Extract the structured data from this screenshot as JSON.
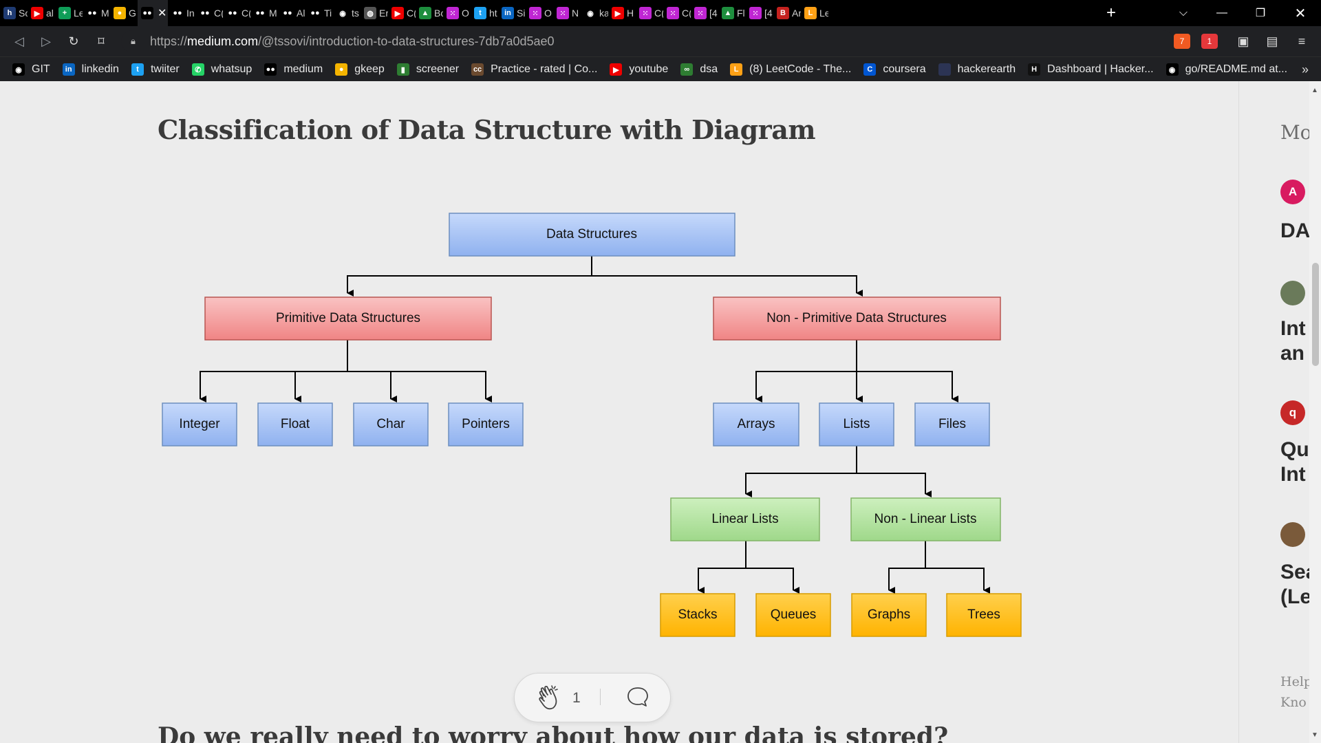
{
  "browser": {
    "tabs": [
      {
        "label": "Sc",
        "icon": "hackerrank-icon",
        "color": "#1f3b73",
        "glyph": "h"
      },
      {
        "label": "al",
        "icon": "youtube-icon",
        "color": "#e00",
        "glyph": "▶"
      },
      {
        "label": "Le",
        "icon": "sheets-icon",
        "color": "#0f9d58",
        "glyph": "+"
      },
      {
        "label": "M",
        "icon": "medium-icon",
        "color": "#000",
        "glyph": "●●"
      },
      {
        "label": "G",
        "icon": "keep-icon",
        "color": "#f4b400",
        "glyph": "●"
      },
      {
        "label": "",
        "icon": "medium-icon",
        "color": "#000",
        "glyph": "●●",
        "active": true
      },
      {
        "label": "In",
        "icon": "medium-icon",
        "color": "#000",
        "glyph": "●●"
      },
      {
        "label": "C(",
        "icon": "medium-icon",
        "color": "#000",
        "glyph": "●●"
      },
      {
        "label": "C(",
        "icon": "medium-icon",
        "color": "#000",
        "glyph": "●●"
      },
      {
        "label": "M",
        "icon": "medium-icon",
        "color": "#000",
        "glyph": "●●"
      },
      {
        "label": "Al",
        "icon": "medium-icon",
        "color": "#000",
        "glyph": "●●"
      },
      {
        "label": "Ti",
        "icon": "medium-icon",
        "color": "#000",
        "glyph": "●●"
      },
      {
        "label": "ts",
        "icon": "github-icon",
        "color": "#000",
        "glyph": "◉"
      },
      {
        "label": "Er",
        "icon": "globe-icon",
        "color": "#555",
        "glyph": "◍"
      },
      {
        "label": "C(",
        "icon": "youtube-icon",
        "color": "#e00",
        "glyph": "▶"
      },
      {
        "label": "Bc",
        "icon": "drive-icon",
        "color": "#1e8e3e",
        "glyph": "▲"
      },
      {
        "label": "O",
        "icon": "dots-icon",
        "color": "#c026d3",
        "glyph": "⁙"
      },
      {
        "label": "ht",
        "icon": "twitter-icon",
        "color": "#1da1f2",
        "glyph": "t"
      },
      {
        "label": "Si",
        "icon": "linkedin-icon",
        "color": "#0a66c2",
        "glyph": "in"
      },
      {
        "label": "O",
        "icon": "dots-icon",
        "color": "#c026d3",
        "glyph": "⁙"
      },
      {
        "label": "N",
        "icon": "dots-icon",
        "color": "#c026d3",
        "glyph": "⁙"
      },
      {
        "label": "ka",
        "icon": "github-icon",
        "color": "#000",
        "glyph": "◉"
      },
      {
        "label": "H",
        "icon": "youtube-icon",
        "color": "#e00",
        "glyph": "▶"
      },
      {
        "label": "C(",
        "icon": "dots-icon",
        "color": "#c026d3",
        "glyph": "⁙"
      },
      {
        "label": "C(",
        "icon": "dots-icon",
        "color": "#c026d3",
        "glyph": "⁙"
      },
      {
        "label": "[4",
        "icon": "dots-icon",
        "color": "#c026d3",
        "glyph": "⁙"
      },
      {
        "label": "Fl",
        "icon": "drive-icon",
        "color": "#1e8e3e",
        "glyph": "▲"
      },
      {
        "label": "[4",
        "icon": "dots-icon",
        "color": "#c026d3",
        "glyph": "⁙"
      },
      {
        "label": "Ar",
        "icon": "pdf-icon",
        "color": "#c5221f",
        "glyph": "B"
      },
      {
        "label": "Le",
        "icon": "leetcode-icon",
        "color": "#ffa116",
        "glyph": "L"
      }
    ],
    "url_prefix": "https://",
    "url_domain": "medium.com",
    "url_path": "/@tssovi/introduction-to-data-structures-7db7a0d5ae0",
    "brave_badge": "7",
    "rewards_badge": "1",
    "bookmarks": [
      {
        "label": "GIT",
        "icon": "github-icon",
        "color": "#000",
        "glyph": "◉"
      },
      {
        "label": "linkedin",
        "icon": "linkedin-icon",
        "color": "#0a66c2",
        "glyph": "in"
      },
      {
        "label": "twiiter",
        "icon": "twitter-icon",
        "color": "#1da1f2",
        "glyph": "t"
      },
      {
        "label": "whatsup",
        "icon": "whatsapp-icon",
        "color": "#25d366",
        "glyph": "✆"
      },
      {
        "label": "medium",
        "icon": "medium-icon",
        "color": "#000",
        "glyph": "●●"
      },
      {
        "label": "gkeep",
        "icon": "keep-icon",
        "color": "#f4b400",
        "glyph": "●"
      },
      {
        "label": "screener",
        "icon": "bar-chart-icon",
        "color": "#2e7d32",
        "glyph": "▮"
      },
      {
        "label": "Practice - rated | Co...",
        "icon": "codechef-icon",
        "color": "#6b4a2f",
        "glyph": "cc"
      },
      {
        "label": "youtube",
        "icon": "youtube-icon",
        "color": "#e00",
        "glyph": "▶"
      },
      {
        "label": "dsa",
        "icon": "link-icon",
        "color": "#2e7d32",
        "glyph": "∞"
      },
      {
        "label": "(8) LeetCode - The...",
        "icon": "leetcode-icon",
        "color": "#ffa116",
        "glyph": "L"
      },
      {
        "label": "coursera",
        "icon": "coursera-icon",
        "color": "#0056d2",
        "glyph": "C"
      },
      {
        "label": "hackerearth",
        "icon": "hackerearth-icon",
        "color": "#2c3454",
        "glyph": ""
      },
      {
        "label": "Dashboard | Hacker...",
        "icon": "hackerrank-icon",
        "color": "#111",
        "glyph": "H"
      },
      {
        "label": "go/README.md at...",
        "icon": "github-icon",
        "color": "#000",
        "glyph": "◉"
      }
    ],
    "bookmarks_more": "»"
  },
  "article": {
    "title": "Classification of Data Structure with Diagram",
    "next_heading": "Do we really need to worry about how our data is stored?",
    "clap_count": "1"
  },
  "diagram": {
    "root": "Data Structures",
    "primitive": "Primitive Data Structures",
    "non_primitive": "Non - Primitive Data Structures",
    "primitive_children": [
      "Integer",
      "Float",
      "Char",
      "Pointers"
    ],
    "non_primitive_children": [
      "Arrays",
      "Lists",
      "Files"
    ],
    "lists_children": [
      "Linear Lists",
      "Non - Linear Lists"
    ],
    "linear_children": [
      "Stacks",
      "Queues"
    ],
    "nonlinear_children": [
      "Graphs",
      "Trees"
    ],
    "colors": {
      "blue": "#a9c4f5",
      "red": "#f4a0a0",
      "green": "#b5e3a2",
      "yellow": "#ffc000"
    }
  },
  "sidebar": {
    "more_label": "Mo",
    "items": [
      {
        "avatar": "A",
        "avatar_color": "#d81b60",
        "title": "DA"
      },
      {
        "avatar": "",
        "avatar_color": "#6a7a5a",
        "title": "Int\nan"
      },
      {
        "avatar": "q",
        "avatar_color": "#c62828",
        "title": "Qu\nInt"
      },
      {
        "avatar": "",
        "avatar_color": "#7a5a3a",
        "title": "Sea\n(Le"
      }
    ],
    "help_text": "Help\nKno"
  }
}
